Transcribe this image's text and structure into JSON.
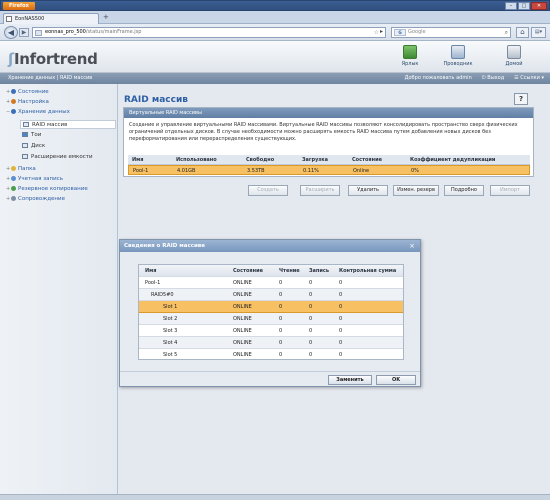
{
  "browser": {
    "menu_label": "Firefox",
    "tab_title": "EonNAS500",
    "new_tab": "+",
    "url_host": "eonnas_pro_500",
    "url_path": "/status/mainFrame.jsp",
    "search_engine": "Google",
    "search_placeholder": "Google",
    "search_engine_badge": "G",
    "win_min": "–",
    "win_max": "□",
    "win_close": "✕"
  },
  "header": {
    "logo_text": "Infortrend",
    "buttons": [
      {
        "label": "Ярлык",
        "icon": "shortcut-icon"
      },
      {
        "label": "Проводник",
        "icon": "explorer-icon"
      },
      {
        "label": "Домой",
        "icon": "home-icon"
      }
    ]
  },
  "statusbar": {
    "path": "Хранение данных | RAID массив",
    "welcome": "Добро пожаловать admin",
    "logout": "Выход",
    "links": "Ссылки"
  },
  "sidebar": {
    "items": [
      {
        "label": "Состояние",
        "color": "#3b6fb8"
      },
      {
        "label": "Настройка",
        "color": "#d07b24"
      },
      {
        "label": "Хранение данных",
        "color": "#3b6fb8"
      },
      {
        "label": "Папка",
        "color": "#e2b43b"
      },
      {
        "label": "Учетная запись",
        "color": "#5a8fd0"
      },
      {
        "label": "Резервное копирование",
        "color": "#4aa04a"
      },
      {
        "label": "Сопровождение",
        "color": "#7d8ea3"
      }
    ],
    "sub_items": [
      {
        "label": "RAID массив"
      },
      {
        "label": "Тои"
      },
      {
        "label": "Диск"
      },
      {
        "label": "Расширение емкости"
      }
    ]
  },
  "main": {
    "title": "RAID массив",
    "help": "?",
    "panel_title": "Виртуальные RAID массивы",
    "description": "Создание и управление виртуальными RAID массивами. Виртуальные RAID массивы позволяют консолидировать пространство сверх физических ограничений отдельных дисков. В случае необходимости можно расширять емкость RAID массива путем добавления новых дисков без переформатирования или перераспределения существующих.",
    "table_headers": [
      "Имя",
      "Использовано",
      "Свободно",
      "Загрузка",
      "Состояние",
      "Коэффициент дедупликации"
    ],
    "table_rows": [
      [
        "Pool-1",
        "4.01GB",
        "3.53TB",
        "0.11%",
        "Online",
        "0%"
      ]
    ],
    "actions": [
      {
        "label": "Создать",
        "enabled": false
      },
      {
        "label": "Расширить",
        "enabled": false
      },
      {
        "label": "Удалить",
        "enabled": true
      },
      {
        "label": "Измен. резерв",
        "enabled": true
      },
      {
        "label": "Подробно",
        "enabled": true
      },
      {
        "label": "Импорт",
        "enabled": false
      }
    ]
  },
  "dialog": {
    "title": "Сведения о RAID массиве",
    "close": "×",
    "headers": [
      "Имя",
      "Состояние",
      "Чтение",
      "Запись",
      "Контрольная сумма"
    ],
    "rows": [
      [
        "Pool-1",
        "ONLINE",
        "0",
        "0",
        "0"
      ],
      [
        "RAID5#0",
        "ONLINE",
        "0",
        "0",
        "0"
      ],
      [
        "Slot 1",
        "ONLINE",
        "0",
        "0",
        "0"
      ],
      [
        "Slot 2",
        "ONLINE",
        "0",
        "0",
        "0"
      ],
      [
        "Slot 3",
        "ONLINE",
        "0",
        "0",
        "0"
      ],
      [
        "Slot 4",
        "ONLINE",
        "0",
        "0",
        "0"
      ],
      [
        "Slot 5",
        "ONLINE",
        "0",
        "0",
        "0"
      ]
    ],
    "replace_label": "Заменить",
    "ok_label": "OK"
  }
}
